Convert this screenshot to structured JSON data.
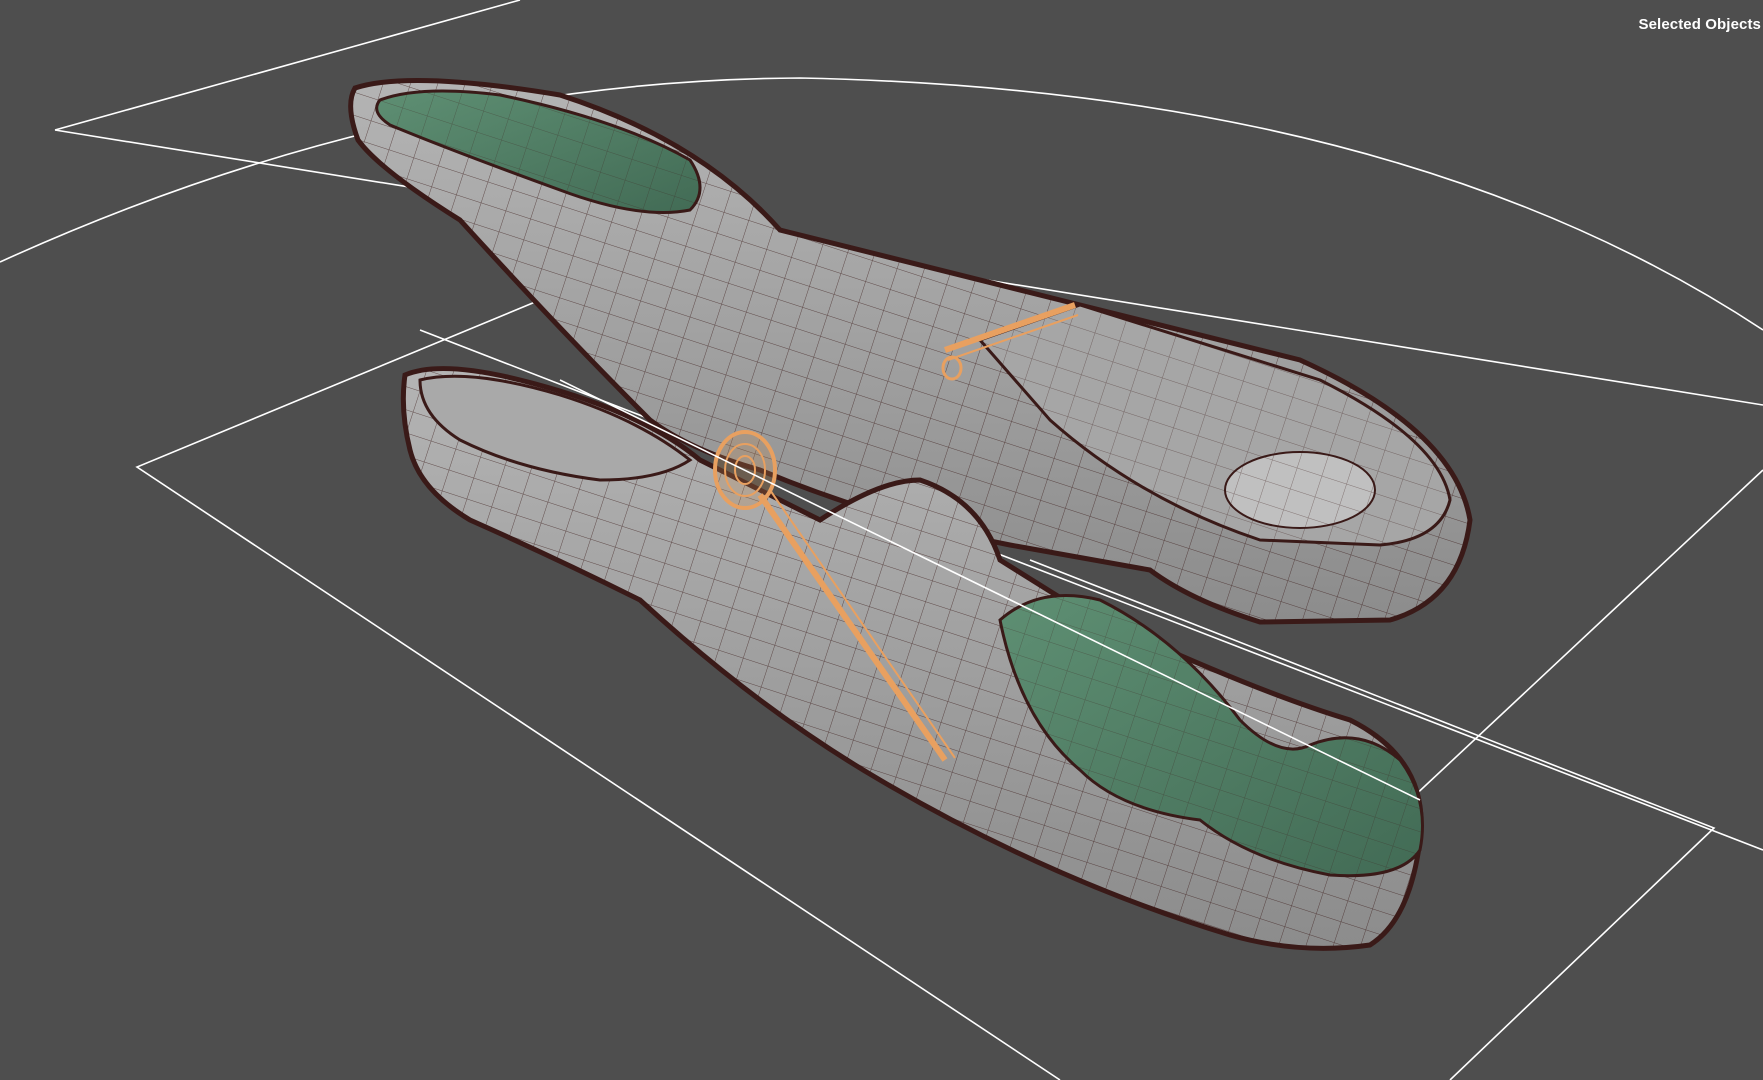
{
  "viewport": {
    "overlay_label": "Selected Objects",
    "background_color": "#4e4e4e",
    "grid_color": "#ffffff",
    "shell_color": "#9a9a9a",
    "wire_color": "#3a1a18",
    "grip_color": "#4f7d63",
    "spring_color": "#e8a060",
    "selected_object": "clothespin-model"
  }
}
